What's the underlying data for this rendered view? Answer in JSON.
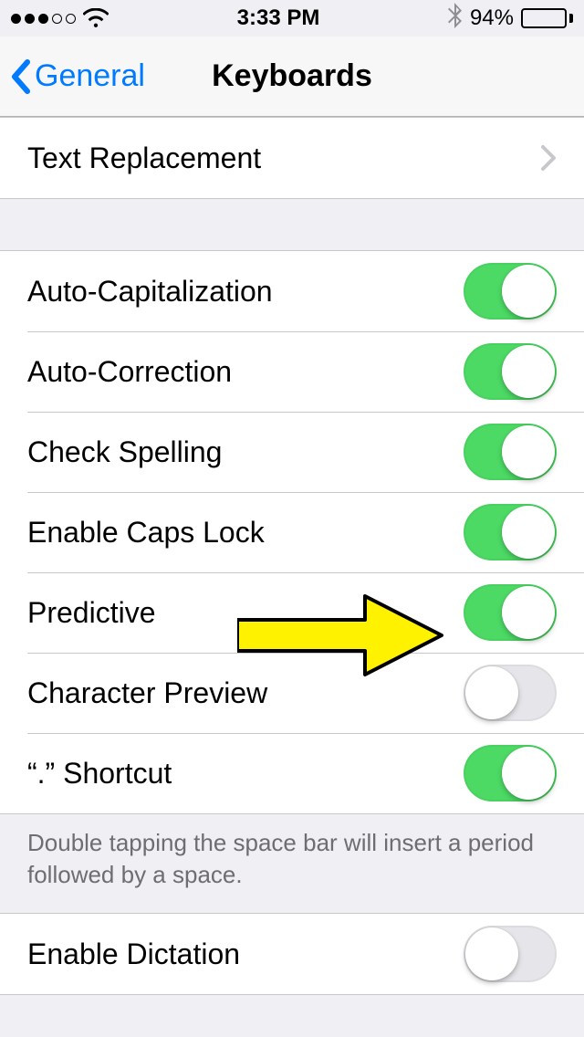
{
  "status": {
    "signal_filled": 3,
    "signal_total": 5,
    "time": "3:33 PM",
    "battery_percent_label": "94%",
    "battery_percent_value": 94
  },
  "nav": {
    "back_label": "General",
    "title": "Keyboards"
  },
  "group_top": [
    {
      "label": "Text Replacement",
      "type": "disclosure"
    }
  ],
  "group_toggles": [
    {
      "label": "Auto-Capitalization",
      "on": true
    },
    {
      "label": "Auto-Correction",
      "on": true
    },
    {
      "label": "Check Spelling",
      "on": true
    },
    {
      "label": "Enable Caps Lock",
      "on": true
    },
    {
      "label": "Predictive",
      "on": true
    },
    {
      "label": "Character Preview",
      "on": false
    },
    {
      "label": "“.” Shortcut",
      "on": true
    }
  ],
  "toggles_footer": "Double tapping the space bar will insert a period followed by a space.",
  "group_bottom": [
    {
      "label": "Enable Dictation",
      "on": false
    }
  ],
  "annotation": {
    "target_row": "Predictive",
    "kind": "arrow",
    "color": "#fef200"
  }
}
